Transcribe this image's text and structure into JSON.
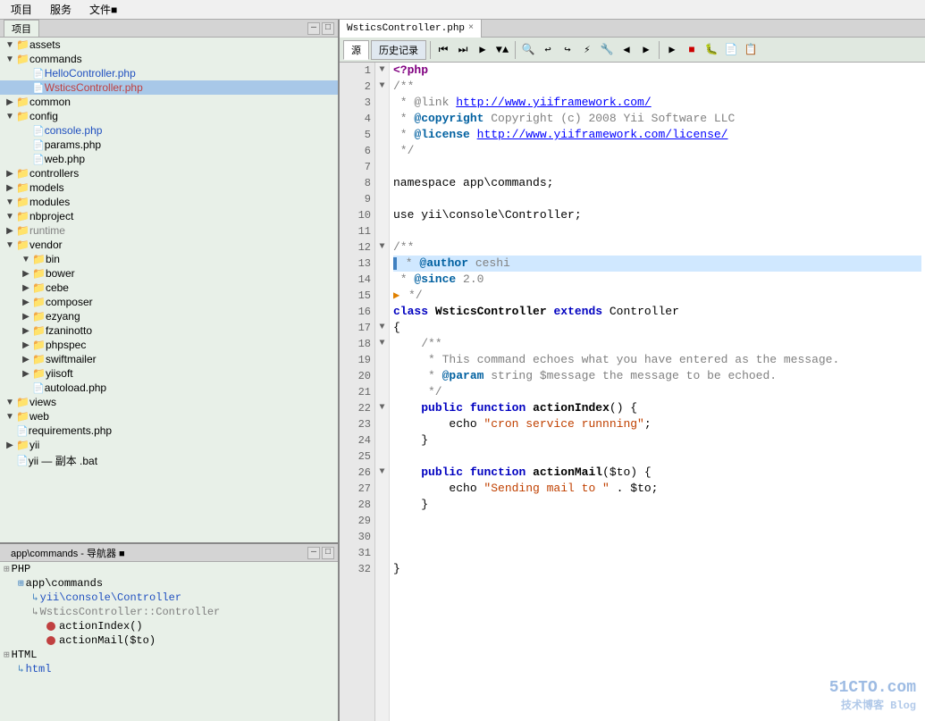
{
  "menu": {
    "items": [
      "项目",
      "服务",
      "文件■"
    ]
  },
  "left_panel": {
    "tab": "项目",
    "tree": [
      {
        "indent": 0,
        "expanded": true,
        "type": "folder-yellow",
        "label": "assets",
        "bold": false
      },
      {
        "indent": 0,
        "expanded": true,
        "type": "folder-yellow",
        "label": "commands",
        "bold": false
      },
      {
        "indent": 1,
        "expanded": false,
        "type": "file-blue",
        "label": "HelloController.php",
        "bold": false,
        "color": "blue"
      },
      {
        "indent": 1,
        "expanded": false,
        "type": "file-red",
        "label": "WsticsController.php",
        "bold": false,
        "color": "red"
      },
      {
        "indent": 0,
        "expanded": false,
        "type": "folder-yellow",
        "label": "common",
        "bold": false
      },
      {
        "indent": 0,
        "expanded": true,
        "type": "folder-yellow-a",
        "label": "config",
        "bold": false
      },
      {
        "indent": 1,
        "expanded": false,
        "type": "file-blue",
        "label": "console.php",
        "bold": false,
        "color": "blue"
      },
      {
        "indent": 1,
        "expanded": false,
        "type": "file-gray",
        "label": "params.php",
        "bold": false
      },
      {
        "indent": 1,
        "expanded": false,
        "type": "file-gray",
        "label": "web.php",
        "bold": false
      },
      {
        "indent": 0,
        "expanded": false,
        "type": "folder-yellow",
        "label": "controllers",
        "bold": false
      },
      {
        "indent": 0,
        "expanded": false,
        "type": "folder-yellow",
        "label": "models",
        "bold": false
      },
      {
        "indent": 0,
        "expanded": true,
        "type": "folder-yellow-a",
        "label": "modules",
        "bold": false
      },
      {
        "indent": 0,
        "expanded": true,
        "type": "folder-yellow-a",
        "label": "nbproject",
        "bold": false
      },
      {
        "indent": 0,
        "expanded": false,
        "type": "folder-gray",
        "label": "runtime",
        "bold": false,
        "color": "gray"
      },
      {
        "indent": 0,
        "expanded": true,
        "type": "folder-red",
        "label": "vendor",
        "bold": false
      },
      {
        "indent": 1,
        "expanded": true,
        "type": "folder-yellow",
        "label": "bin",
        "bold": false
      },
      {
        "indent": 1,
        "expanded": false,
        "type": "folder-yellow",
        "label": "bower",
        "bold": false
      },
      {
        "indent": 1,
        "expanded": false,
        "type": "folder-yellow",
        "label": "cebe",
        "bold": false
      },
      {
        "indent": 1,
        "expanded": false,
        "type": "folder-yellow",
        "label": "composer",
        "bold": false
      },
      {
        "indent": 1,
        "expanded": false,
        "type": "folder-yellow",
        "label": "ezyang",
        "bold": false
      },
      {
        "indent": 1,
        "expanded": false,
        "type": "folder-yellow",
        "label": "fzaninotto",
        "bold": false
      },
      {
        "indent": 1,
        "expanded": false,
        "type": "folder-yellow",
        "label": "phpspec",
        "bold": false
      },
      {
        "indent": 1,
        "expanded": false,
        "type": "folder-yellow",
        "label": "swiftmailer",
        "bold": false
      },
      {
        "indent": 1,
        "expanded": false,
        "type": "folder-red",
        "label": "yiisoft",
        "bold": false
      },
      {
        "indent": 1,
        "expanded": false,
        "type": "file-gray",
        "label": "autoload.php",
        "bold": false
      },
      {
        "indent": 0,
        "expanded": true,
        "type": "folder-yellow",
        "label": "views",
        "bold": false
      },
      {
        "indent": 0,
        "expanded": true,
        "type": "folder-yellow-a",
        "label": "web",
        "bold": false
      },
      {
        "indent": 0,
        "expanded": false,
        "type": "file-gray",
        "label": "requirements.php",
        "bold": false
      },
      {
        "indent": 0,
        "expanded": false,
        "type": "folder-yellow",
        "label": "yii",
        "bold": false
      },
      {
        "indent": 0,
        "expanded": false,
        "type": "file-gray",
        "label": "yii — 副本 .bat",
        "bold": false
      }
    ]
  },
  "bottom_panel": {
    "title": "app\\commands - 导航器 ■",
    "tree": [
      {
        "indent": 0,
        "expanded": true,
        "type": "folder-gray2",
        "label": "PHP"
      },
      {
        "indent": 1,
        "expanded": true,
        "type": "folder-blue2",
        "label": "app\\commands"
      },
      {
        "indent": 2,
        "expanded": false,
        "type": "item-blue",
        "label": "yii\\console\\Controller"
      },
      {
        "indent": 2,
        "expanded": true,
        "type": "item-red",
        "label": "WsticsController::Controller"
      },
      {
        "indent": 3,
        "expanded": false,
        "type": "circle-red",
        "label": "actionIndex()"
      },
      {
        "indent": 3,
        "expanded": false,
        "type": "circle-red",
        "label": "actionMail($to)"
      }
    ],
    "extra": [
      {
        "indent": 0,
        "expanded": true,
        "type": "folder-gray2",
        "label": "HTML"
      },
      {
        "indent": 1,
        "expanded": false,
        "type": "item-blue2",
        "label": "html"
      }
    ]
  },
  "editor": {
    "tabs": [
      {
        "label": "WsticsController.php",
        "active": true
      },
      {
        "label": "×",
        "active": false
      }
    ],
    "toolbar_buttons": [
      "源",
      "历史记录"
    ],
    "lines": [
      {
        "num": 1,
        "fold": "▼",
        "highlight": false,
        "arrow": false,
        "content": [
          {
            "type": "tag",
            "text": "<?php"
          }
        ]
      },
      {
        "num": 2,
        "fold": "▼",
        "highlight": false,
        "arrow": false,
        "content": [
          {
            "type": "comment",
            "text": "/**"
          }
        ]
      },
      {
        "num": 3,
        "fold": "",
        "highlight": false,
        "arrow": false,
        "content": [
          {
            "type": "comment",
            "text": " * @link "
          },
          {
            "type": "link",
            "text": "http://www.yiiframework.com/"
          }
        ]
      },
      {
        "num": 4,
        "fold": "",
        "highlight": false,
        "arrow": false,
        "content": [
          {
            "type": "comment",
            "text": " * "
          },
          {
            "type": "doc-tag",
            "text": "@copyright"
          },
          {
            "type": "comment",
            "text": " Copyright (c) 2008 Yii Software LLC"
          }
        ]
      },
      {
        "num": 5,
        "fold": "",
        "highlight": false,
        "arrow": false,
        "content": [
          {
            "type": "comment",
            "text": " * "
          },
          {
            "type": "doc-tag",
            "text": "@license"
          },
          {
            "type": "comment",
            "text": " "
          },
          {
            "type": "link",
            "text": "http://www.yiiframework.com/license/"
          }
        ]
      },
      {
        "num": 6,
        "fold": "",
        "highlight": false,
        "arrow": false,
        "content": [
          {
            "type": "comment",
            "text": " */"
          }
        ]
      },
      {
        "num": 7,
        "fold": "",
        "highlight": false,
        "arrow": false,
        "content": []
      },
      {
        "num": 8,
        "fold": "",
        "highlight": false,
        "arrow": false,
        "content": [
          {
            "type": "normal",
            "text": "namespace app\\commands;"
          }
        ]
      },
      {
        "num": 9,
        "fold": "",
        "highlight": false,
        "arrow": false,
        "content": []
      },
      {
        "num": 10,
        "fold": "",
        "highlight": false,
        "arrow": false,
        "content": [
          {
            "type": "normal",
            "text": "use yii\\console\\Controller;"
          }
        ]
      },
      {
        "num": 11,
        "fold": "",
        "highlight": false,
        "arrow": false,
        "content": []
      },
      {
        "num": 12,
        "fold": "▼",
        "highlight": false,
        "arrow": false,
        "content": [
          {
            "type": "comment",
            "text": "/**"
          }
        ]
      },
      {
        "num": 13,
        "fold": "",
        "highlight": true,
        "arrow": false,
        "content": [
          {
            "type": "comment",
            "text": " * "
          },
          {
            "type": "doc-tag",
            "text": "@author"
          },
          {
            "type": "comment",
            "text": " ceshi"
          }
        ]
      },
      {
        "num": 14,
        "fold": "",
        "highlight": false,
        "arrow": false,
        "content": [
          {
            "type": "comment",
            "text": " * "
          },
          {
            "type": "doc-tag",
            "text": "@since"
          },
          {
            "type": "comment",
            "text": " 2.0"
          }
        ]
      },
      {
        "num": 15,
        "fold": "",
        "highlight": false,
        "arrow": true,
        "content": [
          {
            "type": "comment",
            "text": " */"
          }
        ]
      },
      {
        "num": 16,
        "fold": "",
        "highlight": false,
        "arrow": false,
        "content": [
          {
            "type": "kw",
            "text": "class"
          },
          {
            "type": "normal",
            "text": " "
          },
          {
            "type": "class-name",
            "text": "WsticsController"
          },
          {
            "type": "normal",
            "text": " "
          },
          {
            "type": "kw",
            "text": "extends"
          },
          {
            "type": "normal",
            "text": " Controller"
          }
        ]
      },
      {
        "num": 17,
        "fold": "▼",
        "highlight": false,
        "arrow": false,
        "content": [
          {
            "type": "normal",
            "text": "{"
          }
        ]
      },
      {
        "num": 18,
        "fold": "▼",
        "highlight": false,
        "arrow": false,
        "content": [
          {
            "type": "normal",
            "text": "    "
          },
          {
            "type": "comment",
            "text": "/**"
          }
        ]
      },
      {
        "num": 19,
        "fold": "",
        "highlight": false,
        "arrow": false,
        "content": [
          {
            "type": "comment",
            "text": "     * This command echoes what you have entered as the message."
          }
        ]
      },
      {
        "num": 20,
        "fold": "",
        "highlight": false,
        "arrow": false,
        "content": [
          {
            "type": "comment",
            "text": "     * "
          },
          {
            "type": "doc-tag",
            "text": "@param"
          },
          {
            "type": "comment",
            "text": " string $message the message to be echoed."
          }
        ]
      },
      {
        "num": 21,
        "fold": "",
        "highlight": false,
        "arrow": false,
        "content": [
          {
            "type": "comment",
            "text": "     */"
          }
        ]
      },
      {
        "num": 22,
        "fold": "▼",
        "highlight": false,
        "arrow": false,
        "content": [
          {
            "type": "normal",
            "text": "    "
          },
          {
            "type": "kw",
            "text": "public"
          },
          {
            "type": "normal",
            "text": " "
          },
          {
            "type": "kw",
            "text": "function"
          },
          {
            "type": "normal",
            "text": " "
          },
          {
            "type": "class-name",
            "text": "actionIndex"
          },
          {
            "type": "normal",
            "text": "() {"
          }
        ]
      },
      {
        "num": 23,
        "fold": "",
        "highlight": false,
        "arrow": false,
        "content": [
          {
            "type": "normal",
            "text": "        echo "
          },
          {
            "type": "string",
            "text": "\"cron service runnning\""
          },
          {
            "type": "normal",
            "text": ";"
          }
        ]
      },
      {
        "num": 24,
        "fold": "",
        "highlight": false,
        "arrow": false,
        "content": [
          {
            "type": "normal",
            "text": "    }"
          }
        ]
      },
      {
        "num": 25,
        "fold": "",
        "highlight": false,
        "arrow": false,
        "content": []
      },
      {
        "num": 26,
        "fold": "▼",
        "highlight": false,
        "arrow": false,
        "content": [
          {
            "type": "normal",
            "text": "    "
          },
          {
            "type": "kw",
            "text": "public"
          },
          {
            "type": "normal",
            "text": " "
          },
          {
            "type": "kw",
            "text": "function"
          },
          {
            "type": "normal",
            "text": " "
          },
          {
            "type": "class-name",
            "text": "actionMail"
          },
          {
            "type": "normal",
            "text": "($to) {"
          }
        ]
      },
      {
        "num": 27,
        "fold": "",
        "highlight": false,
        "arrow": false,
        "content": [
          {
            "type": "normal",
            "text": "        echo "
          },
          {
            "type": "string",
            "text": "\"Sending mail to \""
          },
          {
            "type": "normal",
            "text": " . $to;"
          }
        ]
      },
      {
        "num": 28,
        "fold": "",
        "highlight": false,
        "arrow": false,
        "content": [
          {
            "type": "normal",
            "text": "    }"
          }
        ]
      },
      {
        "num": 29,
        "fold": "",
        "highlight": false,
        "arrow": false,
        "content": []
      },
      {
        "num": 30,
        "fold": "",
        "highlight": false,
        "arrow": false,
        "content": []
      },
      {
        "num": 31,
        "fold": "",
        "highlight": false,
        "arrow": false,
        "content": []
      },
      {
        "num": 32,
        "fold": "",
        "highlight": false,
        "arrow": false,
        "content": [
          {
            "type": "normal",
            "text": "}"
          }
        ]
      }
    ]
  },
  "watermark": {
    "line1": "51CTO.com",
    "line2": "技术博客 Blog"
  }
}
